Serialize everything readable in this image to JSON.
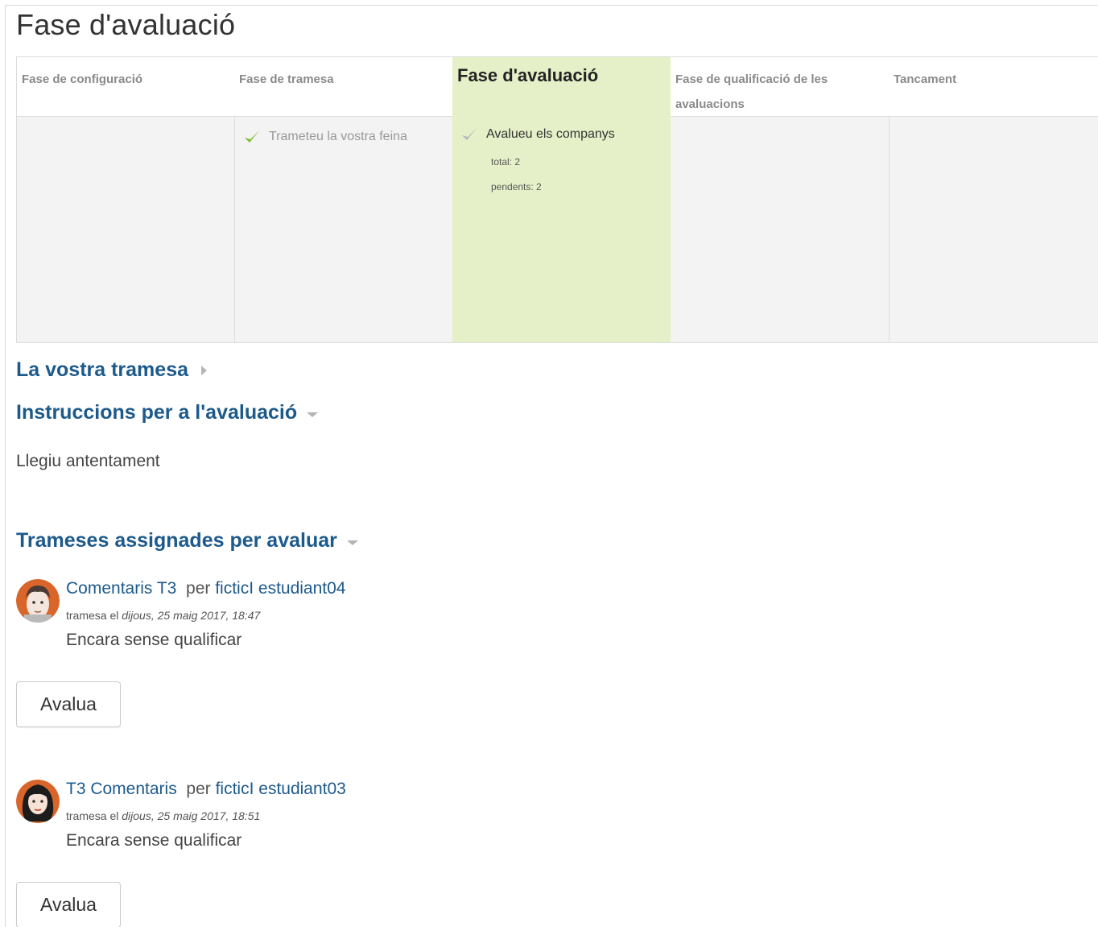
{
  "page": {
    "title": "Fase d'avaluació"
  },
  "phases": [
    {
      "label": "Fase de configuració",
      "tasks": []
    },
    {
      "label": "Fase de tramesa",
      "tasks": [
        {
          "label": "Trameteu la vostra feina",
          "done": true
        }
      ]
    },
    {
      "label": "Fase d'avaluació",
      "active": true,
      "tasks": [
        {
          "label": "Avalueu els companys",
          "done": false,
          "details": [
            "total: 2",
            "pendents: 2"
          ]
        }
      ]
    },
    {
      "label": "Fase de qualificació de les avaluacions",
      "tasks": []
    },
    {
      "label": "Tancament",
      "tasks": []
    }
  ],
  "sections": {
    "your_submission": "La vostra tramesa",
    "instructions": "Instruccions per a l'avaluació",
    "instructions_text": "Llegiu antentament",
    "assigned": "Trameses assignades per avaluar"
  },
  "submissions": [
    {
      "title": "Comentaris T3",
      "by": "per",
      "author": "ficticI estudiant04",
      "submitted_prefix": "tramesa el",
      "submitted_date": "dijous, 25 maig 2017, 18:47",
      "status": "Encara sense qualificar",
      "button": "Avalua"
    },
    {
      "title": "T3 Comentaris",
      "by": "per",
      "author": "ficticI estudiant03",
      "submitted_prefix": "tramesa el",
      "submitted_date": "dijous, 25 maig 2017, 18:51",
      "status": "Encara sense qualificar",
      "button": "Avalua"
    }
  ],
  "colors": {
    "link": "#1d5a8c",
    "active_phase": "#e5f0c8",
    "check": "#7cbd2a"
  },
  "icons": {
    "check": "check-icon",
    "collapsed": "caret-right-icon",
    "expanded": "caret-down-icon"
  }
}
